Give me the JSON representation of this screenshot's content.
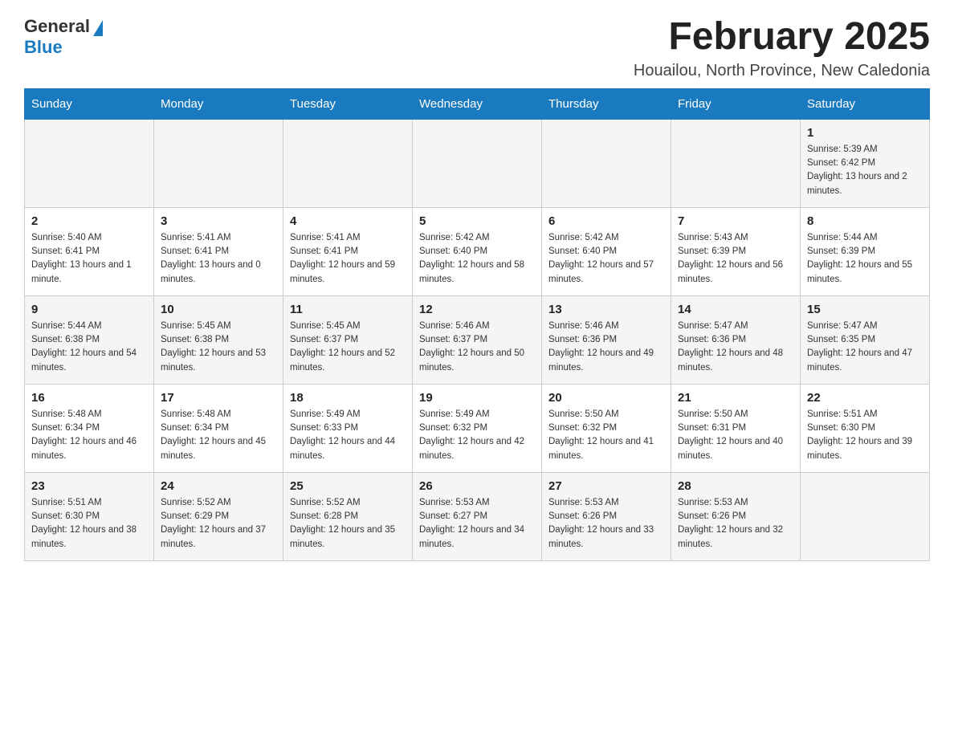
{
  "header": {
    "logo_general": "General",
    "logo_blue": "Blue",
    "month_title": "February 2025",
    "location": "Houailou, North Province, New Caledonia"
  },
  "weekdays": [
    "Sunday",
    "Monday",
    "Tuesday",
    "Wednesday",
    "Thursday",
    "Friday",
    "Saturday"
  ],
  "weeks": [
    [
      {
        "day": "",
        "sunrise": "",
        "sunset": "",
        "daylight": ""
      },
      {
        "day": "",
        "sunrise": "",
        "sunset": "",
        "daylight": ""
      },
      {
        "day": "",
        "sunrise": "",
        "sunset": "",
        "daylight": ""
      },
      {
        "day": "",
        "sunrise": "",
        "sunset": "",
        "daylight": ""
      },
      {
        "day": "",
        "sunrise": "",
        "sunset": "",
        "daylight": ""
      },
      {
        "day": "",
        "sunrise": "",
        "sunset": "",
        "daylight": ""
      },
      {
        "day": "1",
        "sunrise": "Sunrise: 5:39 AM",
        "sunset": "Sunset: 6:42 PM",
        "daylight": "Daylight: 13 hours and 2 minutes."
      }
    ],
    [
      {
        "day": "2",
        "sunrise": "Sunrise: 5:40 AM",
        "sunset": "Sunset: 6:41 PM",
        "daylight": "Daylight: 13 hours and 1 minute."
      },
      {
        "day": "3",
        "sunrise": "Sunrise: 5:41 AM",
        "sunset": "Sunset: 6:41 PM",
        "daylight": "Daylight: 13 hours and 0 minutes."
      },
      {
        "day": "4",
        "sunrise": "Sunrise: 5:41 AM",
        "sunset": "Sunset: 6:41 PM",
        "daylight": "Daylight: 12 hours and 59 minutes."
      },
      {
        "day": "5",
        "sunrise": "Sunrise: 5:42 AM",
        "sunset": "Sunset: 6:40 PM",
        "daylight": "Daylight: 12 hours and 58 minutes."
      },
      {
        "day": "6",
        "sunrise": "Sunrise: 5:42 AM",
        "sunset": "Sunset: 6:40 PM",
        "daylight": "Daylight: 12 hours and 57 minutes."
      },
      {
        "day": "7",
        "sunrise": "Sunrise: 5:43 AM",
        "sunset": "Sunset: 6:39 PM",
        "daylight": "Daylight: 12 hours and 56 minutes."
      },
      {
        "day": "8",
        "sunrise": "Sunrise: 5:44 AM",
        "sunset": "Sunset: 6:39 PM",
        "daylight": "Daylight: 12 hours and 55 minutes."
      }
    ],
    [
      {
        "day": "9",
        "sunrise": "Sunrise: 5:44 AM",
        "sunset": "Sunset: 6:38 PM",
        "daylight": "Daylight: 12 hours and 54 minutes."
      },
      {
        "day": "10",
        "sunrise": "Sunrise: 5:45 AM",
        "sunset": "Sunset: 6:38 PM",
        "daylight": "Daylight: 12 hours and 53 minutes."
      },
      {
        "day": "11",
        "sunrise": "Sunrise: 5:45 AM",
        "sunset": "Sunset: 6:37 PM",
        "daylight": "Daylight: 12 hours and 52 minutes."
      },
      {
        "day": "12",
        "sunrise": "Sunrise: 5:46 AM",
        "sunset": "Sunset: 6:37 PM",
        "daylight": "Daylight: 12 hours and 50 minutes."
      },
      {
        "day": "13",
        "sunrise": "Sunrise: 5:46 AM",
        "sunset": "Sunset: 6:36 PM",
        "daylight": "Daylight: 12 hours and 49 minutes."
      },
      {
        "day": "14",
        "sunrise": "Sunrise: 5:47 AM",
        "sunset": "Sunset: 6:36 PM",
        "daylight": "Daylight: 12 hours and 48 minutes."
      },
      {
        "day": "15",
        "sunrise": "Sunrise: 5:47 AM",
        "sunset": "Sunset: 6:35 PM",
        "daylight": "Daylight: 12 hours and 47 minutes."
      }
    ],
    [
      {
        "day": "16",
        "sunrise": "Sunrise: 5:48 AM",
        "sunset": "Sunset: 6:34 PM",
        "daylight": "Daylight: 12 hours and 46 minutes."
      },
      {
        "day": "17",
        "sunrise": "Sunrise: 5:48 AM",
        "sunset": "Sunset: 6:34 PM",
        "daylight": "Daylight: 12 hours and 45 minutes."
      },
      {
        "day": "18",
        "sunrise": "Sunrise: 5:49 AM",
        "sunset": "Sunset: 6:33 PM",
        "daylight": "Daylight: 12 hours and 44 minutes."
      },
      {
        "day": "19",
        "sunrise": "Sunrise: 5:49 AM",
        "sunset": "Sunset: 6:32 PM",
        "daylight": "Daylight: 12 hours and 42 minutes."
      },
      {
        "day": "20",
        "sunrise": "Sunrise: 5:50 AM",
        "sunset": "Sunset: 6:32 PM",
        "daylight": "Daylight: 12 hours and 41 minutes."
      },
      {
        "day": "21",
        "sunrise": "Sunrise: 5:50 AM",
        "sunset": "Sunset: 6:31 PM",
        "daylight": "Daylight: 12 hours and 40 minutes."
      },
      {
        "day": "22",
        "sunrise": "Sunrise: 5:51 AM",
        "sunset": "Sunset: 6:30 PM",
        "daylight": "Daylight: 12 hours and 39 minutes."
      }
    ],
    [
      {
        "day": "23",
        "sunrise": "Sunrise: 5:51 AM",
        "sunset": "Sunset: 6:30 PM",
        "daylight": "Daylight: 12 hours and 38 minutes."
      },
      {
        "day": "24",
        "sunrise": "Sunrise: 5:52 AM",
        "sunset": "Sunset: 6:29 PM",
        "daylight": "Daylight: 12 hours and 37 minutes."
      },
      {
        "day": "25",
        "sunrise": "Sunrise: 5:52 AM",
        "sunset": "Sunset: 6:28 PM",
        "daylight": "Daylight: 12 hours and 35 minutes."
      },
      {
        "day": "26",
        "sunrise": "Sunrise: 5:53 AM",
        "sunset": "Sunset: 6:27 PM",
        "daylight": "Daylight: 12 hours and 34 minutes."
      },
      {
        "day": "27",
        "sunrise": "Sunrise: 5:53 AM",
        "sunset": "Sunset: 6:26 PM",
        "daylight": "Daylight: 12 hours and 33 minutes."
      },
      {
        "day": "28",
        "sunrise": "Sunrise: 5:53 AM",
        "sunset": "Sunset: 6:26 PM",
        "daylight": "Daylight: 12 hours and 32 minutes."
      },
      {
        "day": "",
        "sunrise": "",
        "sunset": "",
        "daylight": ""
      }
    ]
  ]
}
